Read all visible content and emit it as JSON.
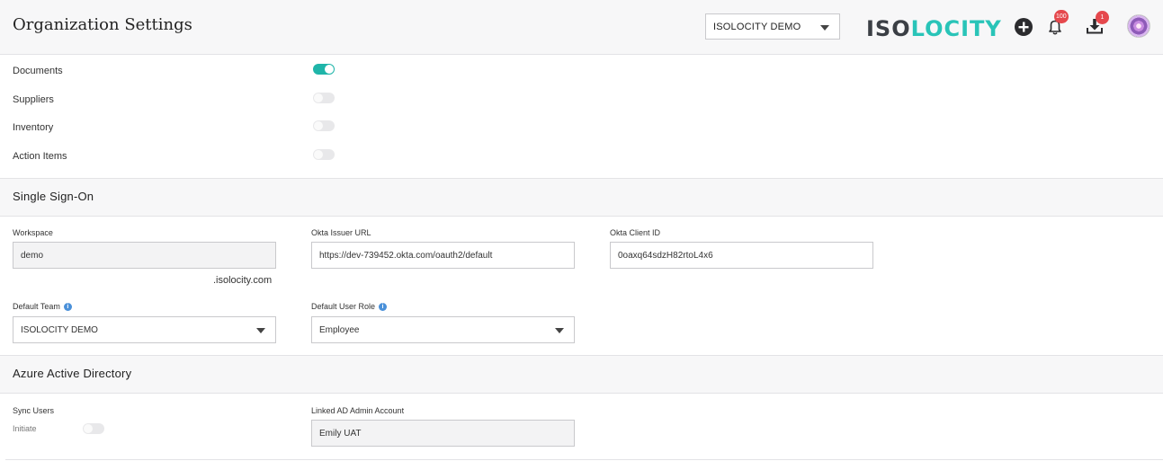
{
  "header": {
    "title": "Organization Settings",
    "org_select": "ISOLOCITY DEMO",
    "logo": {
      "part1": "ISO",
      "part2": "LOCITY"
    },
    "icons": [
      "plus-icon",
      "bell-icon",
      "download-icon",
      "avatar"
    ],
    "notifications_count": "100",
    "downloads_count": "1"
  },
  "modules": [
    {
      "label": "Documents",
      "enabled": true
    },
    {
      "label": "Suppliers",
      "enabled": false
    },
    {
      "label": "Inventory",
      "enabled": false
    },
    {
      "label": "Action Items",
      "enabled": false
    }
  ],
  "sso": {
    "title": "Single Sign-On",
    "workspace_label": "Workspace",
    "workspace_value": "demo",
    "workspace_suffix": ".isolocity.com",
    "okta_issuer_label": "Okta Issuer URL",
    "okta_issuer_value": "https://dev-739452.okta.com/oauth2/default",
    "okta_client_label": "Okta Client ID",
    "okta_client_value": "0oaxq64sdzH82rtoL4x6",
    "default_team_label": "Default Team",
    "default_team_value": "ISOLOCITY DEMO",
    "default_role_label": "Default User Role",
    "default_role_value": "Employee"
  },
  "azure": {
    "title": "Azure Active Directory",
    "sync_label": "Sync Users",
    "initiate_label": "Initiate",
    "linked_label": "Linked AD Admin Account",
    "linked_value": "Emily UAT"
  },
  "colors": {
    "accent": "#1fb5a9",
    "logo_teal": "#29c4b8",
    "badge": "#e5484d"
  }
}
